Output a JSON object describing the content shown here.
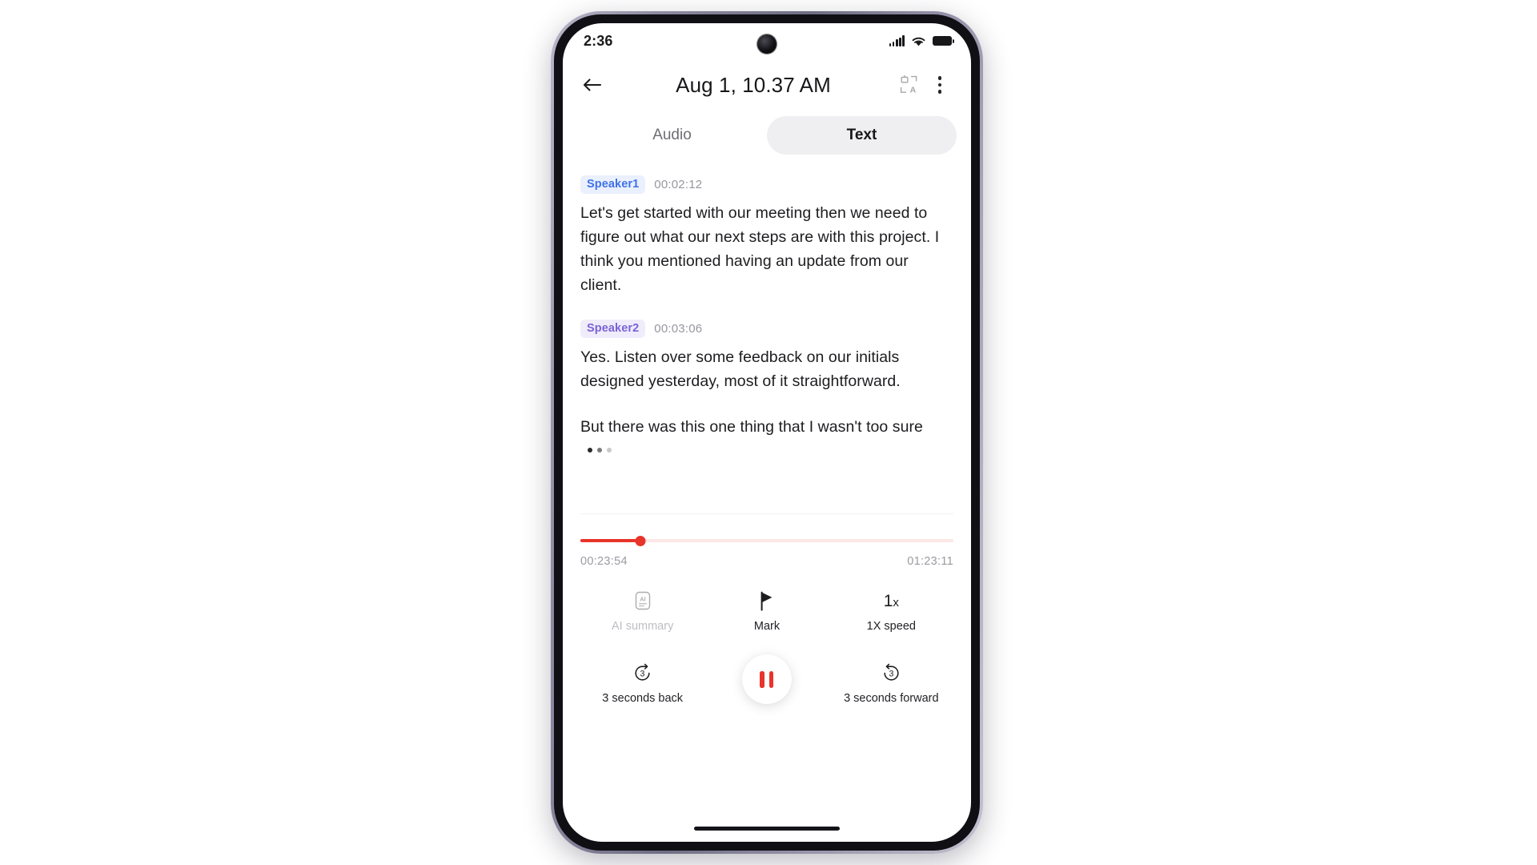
{
  "status_bar": {
    "time": "2:36",
    "icons": [
      "signal-icon",
      "wifi-icon",
      "battery-icon"
    ]
  },
  "header": {
    "back_icon": "back-arrow-icon",
    "title": "Aug 1, 10.37 AM",
    "translate_icon": "translate-icon",
    "menu_icon": "overflow-menu-icon"
  },
  "tabs": [
    {
      "label": "Audio",
      "active": false
    },
    {
      "label": "Text",
      "active": true
    }
  ],
  "transcript": {
    "segments": [
      {
        "speaker": "Speaker1",
        "time": "00:02:12",
        "paragraphs": [
          "Let's get started with our meeting then we need to figure out what our next steps are with this project. I think you mentioned having an update from our client."
        ]
      },
      {
        "speaker": "Speaker2",
        "time": "00:03:06",
        "paragraphs": [
          "Yes. Listen over some feedback on our initials designed yesterday, most of it straightforward.",
          "But there was this one thing that I wasn't too sure"
        ],
        "loading_dots": true
      }
    ]
  },
  "player": {
    "current_time": "00:23:54",
    "total_time": "01:23:11",
    "progress_percent": 16,
    "accent_color": "#e8342a",
    "track_bg_color": "#fbe7e6",
    "controls_row1": [
      {
        "name": "ai-summary",
        "icon": "ai-summary-icon",
        "label": "AI summary",
        "disabled": true
      },
      {
        "name": "mark",
        "icon": "flag-icon",
        "label": "Mark",
        "disabled": false
      },
      {
        "name": "speed",
        "icon": "speed-1x-icon",
        "glyph": "1",
        "glyph_suffix": "x",
        "label": "1X speed",
        "disabled": false
      }
    ],
    "controls_row2": [
      {
        "name": "rewind",
        "icon": "rewind-3s-icon",
        "glyph": "3",
        "label": "3 seconds back"
      },
      {
        "name": "play-pause",
        "icon": "pause-icon",
        "label": ""
      },
      {
        "name": "forward",
        "icon": "forward-3s-icon",
        "glyph": "3",
        "label": "3 seconds forward"
      }
    ]
  },
  "system_nav": {
    "home_indicator": "home-indicator"
  },
  "theme": {
    "speaker1_color": "#3f72e8",
    "speaker1_bg": "#eaf0fe",
    "speaker2_color": "#7b63d6",
    "speaker2_bg": "#f0ecfb",
    "tab_active_bg": "#efeff1"
  }
}
